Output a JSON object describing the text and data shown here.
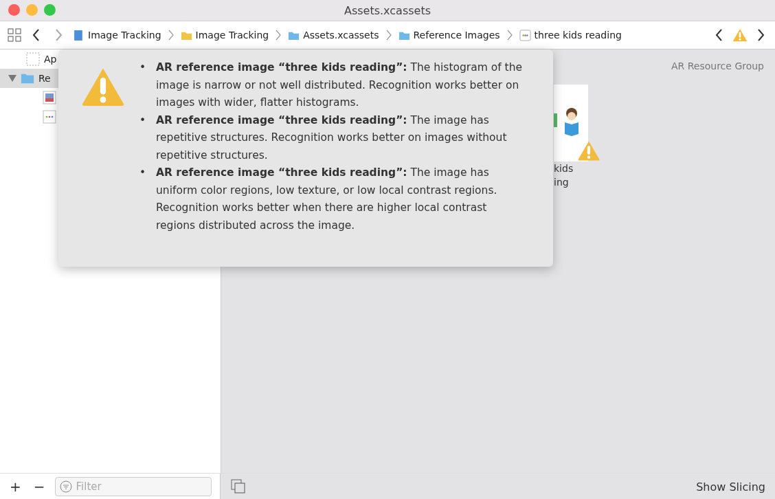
{
  "window": {
    "title": "Assets.xcassets"
  },
  "breadcrumbs": [
    {
      "label": "Image Tracking",
      "kind": "project"
    },
    {
      "label": "Image Tracking",
      "kind": "folder"
    },
    {
      "label": "Assets.xcassets",
      "kind": "catalog"
    },
    {
      "label": "Reference Images",
      "kind": "catalog"
    },
    {
      "label": "three kids reading",
      "kind": "image"
    }
  ],
  "sidebar": {
    "items": [
      {
        "label": "Ap",
        "kind": "appicon",
        "selected": false
      },
      {
        "label": "Re",
        "kind": "folder",
        "selected": true,
        "expanded": true,
        "children": [
          {
            "kind": "photo",
            "selected": false
          },
          {
            "kind": "image",
            "selected": false
          }
        ]
      }
    ]
  },
  "main": {
    "group_label": "AR Resource Group",
    "tile": {
      "label_lines": [
        "kids",
        "ing"
      ],
      "warning": true
    }
  },
  "popover": {
    "warnings": [
      {
        "bullet": "•",
        "text": "**AR reference image “three kids reading”:** The histogram of the image is narrow or not well distributed. Recognition works better on images with wider, flatter histograms."
      },
      {
        "bullet": "•",
        "text": "**AR reference image “three kids reading”:** The image has repetitive structures. Recognition works better on images without repetitive structures."
      },
      {
        "bullet": "•",
        "text": "**AR reference image “three kids reading”:** The image has uniform color regions, low texture, or low local contrast regions. Recognition works better when there are higher local contrast regions distributed across the image."
      }
    ]
  },
  "bottom": {
    "add": "+",
    "remove": "−",
    "filter_placeholder": "Filter",
    "show_slicing": "Show Slicing"
  }
}
